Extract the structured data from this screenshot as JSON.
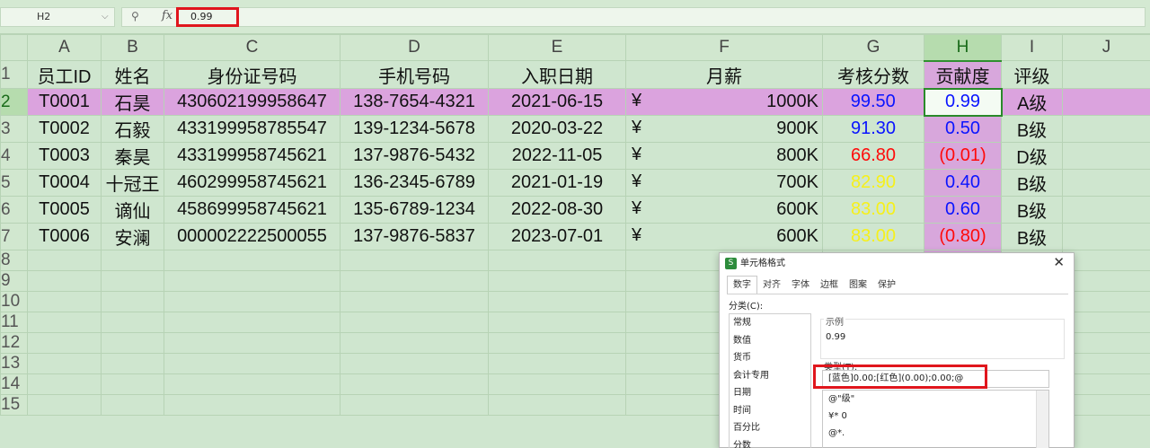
{
  "formula_bar": {
    "cell_ref": "H2",
    "formula": "0.99"
  },
  "columns": [
    "A",
    "B",
    "C",
    "D",
    "E",
    "F",
    "G",
    "H",
    "I",
    "J"
  ],
  "row_numbers": [
    "1",
    "2",
    "3",
    "4",
    "5",
    "6",
    "7",
    "8",
    "9",
    "10",
    "11",
    "12",
    "13",
    "14",
    "15"
  ],
  "headers": [
    "员工ID",
    "姓名",
    "身份证号码",
    "手机号码",
    "入职日期",
    "月薪",
    "考核分数",
    "贡献度",
    "评级"
  ],
  "rows": [
    {
      "id": "T0001",
      "name": "石昊",
      "idcard": "430602199958647",
      "phone": "138-7654-4321",
      "date": "2021-06-15",
      "currency": "¥",
      "salary": "1000K",
      "score": "99.50",
      "score_color": "blue",
      "contrib": "0.99",
      "contrib_color": "blue",
      "grade": "A级"
    },
    {
      "id": "T0002",
      "name": "石毅",
      "idcard": "433199958785547",
      "phone": "139-1234-5678",
      "date": "2020-03-22",
      "currency": "¥",
      "salary": "900K",
      "score": "91.30",
      "score_color": "blue",
      "contrib": "0.50",
      "contrib_color": "blue",
      "grade": "B级"
    },
    {
      "id": "T0003",
      "name": "秦昊",
      "idcard": "433199958745621",
      "phone": "137-9876-5432",
      "date": "2022-11-05",
      "currency": "¥",
      "salary": "800K",
      "score": "66.80",
      "score_color": "red",
      "contrib": "(0.01)",
      "contrib_color": "red",
      "grade": "D级"
    },
    {
      "id": "T0004",
      "name": "十冠王",
      "idcard": "460299958745621",
      "phone": "136-2345-6789",
      "date": "2021-01-19",
      "currency": "¥",
      "salary": "700K",
      "score": "82.90",
      "score_color": "yellow",
      "contrib": "0.40",
      "contrib_color": "blue",
      "grade": "B级"
    },
    {
      "id": "T0005",
      "name": "谪仙",
      "idcard": "458699958745621",
      "phone": "135-6789-1234",
      "date": "2022-08-30",
      "currency": "¥",
      "salary": "600K",
      "score": "83.00",
      "score_color": "yellow",
      "contrib": "0.60",
      "contrib_color": "blue",
      "grade": "B级"
    },
    {
      "id": "T0006",
      "name": "安澜",
      "idcard": "000002222500055",
      "phone": "137-9876-5837",
      "date": "2023-07-01",
      "currency": "¥",
      "salary": "600K",
      "score": "83.00",
      "score_color": "yellow",
      "contrib": "(0.80)",
      "contrib_color": "red",
      "grade": "B级"
    }
  ],
  "dialog": {
    "title": "单元格格式",
    "tabs": [
      "数字",
      "对齐",
      "字体",
      "边框",
      "图案",
      "保护"
    ],
    "category_label": "分类(C):",
    "categories": [
      "常规",
      "数值",
      "货币",
      "会计专用",
      "日期",
      "时间",
      "百分比",
      "分数"
    ],
    "sample_label": "示例",
    "sample_value": "0.99",
    "type_label": "类型(T):",
    "type_value": "[蓝色]0.00;[红色](0.00);0.00;@",
    "type_options": [
      "@\"级\"",
      "¥* 0",
      "@*."
    ]
  },
  "colors": {
    "blue": "#0a14ff",
    "red": "#ff0a0a",
    "yellow": "#f6f01a",
    "highlight": "#dba3de",
    "annotation_red": "#e0161d"
  }
}
